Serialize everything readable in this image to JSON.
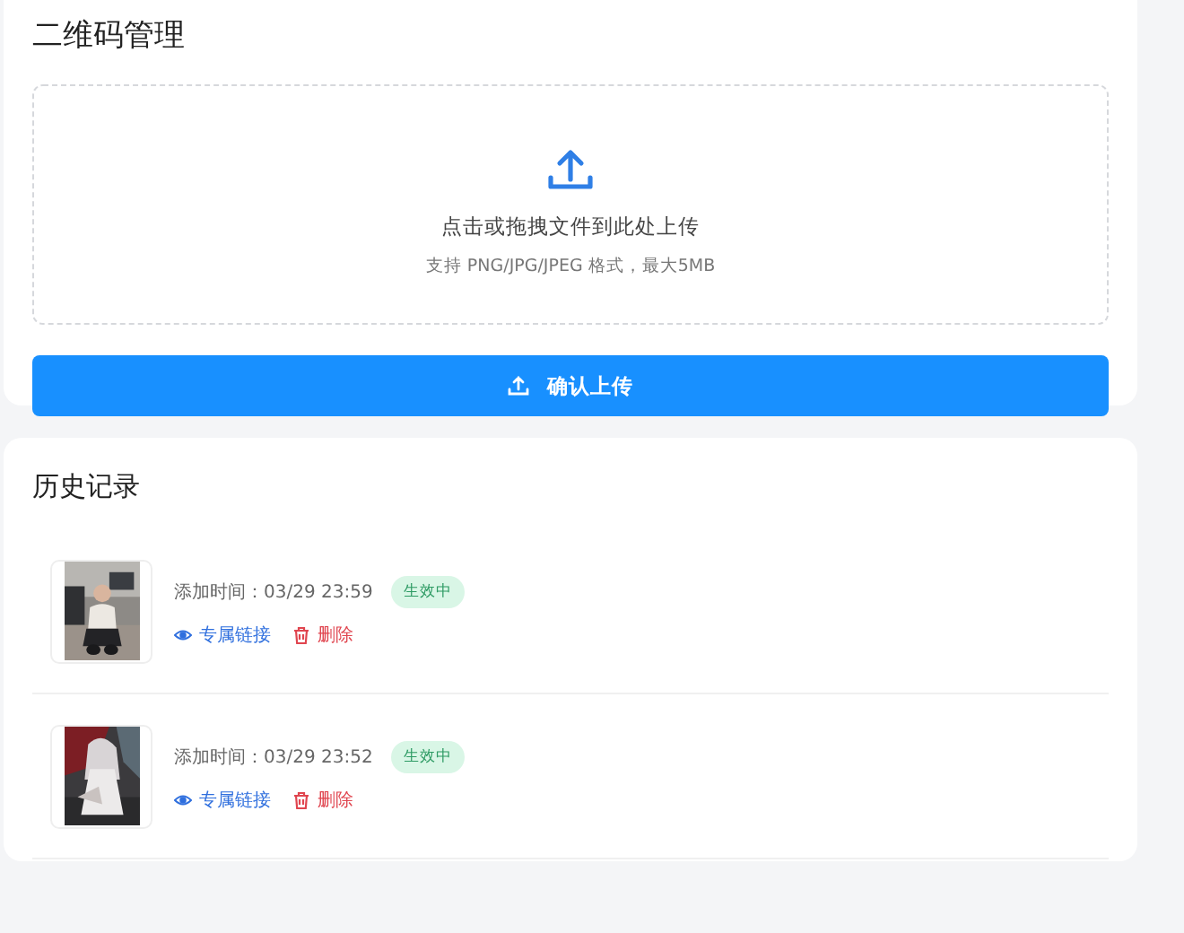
{
  "upload_card": {
    "title": "二维码管理",
    "dropzone": {
      "prompt": "点击或拖拽文件到此处上传",
      "hint": "支持 PNG/JPG/JPEG 格式，最大5MB"
    },
    "submit_button": "确认上传"
  },
  "history": {
    "title": "历史记录",
    "records": [
      {
        "added": "添加时间：03/29 23:59",
        "status": "生效中",
        "link": "专属链接",
        "delete": "删除"
      },
      {
        "added": "添加时间：03/29 23:52",
        "status": "生效中",
        "link": "专属链接",
        "delete": "删除"
      }
    ]
  }
}
